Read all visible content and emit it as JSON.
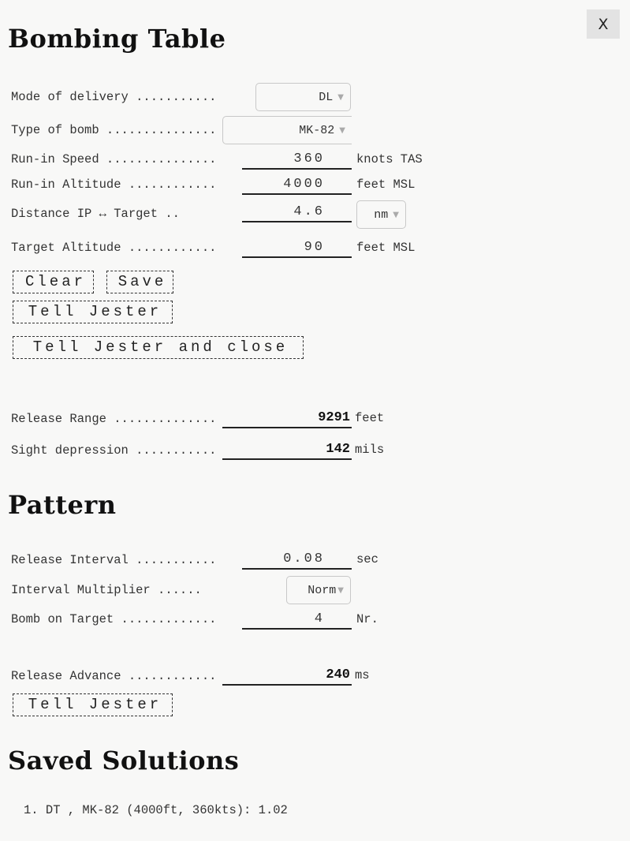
{
  "close_label": "X",
  "headings": {
    "bombing_table": "Bombing Table",
    "pattern": "Pattern",
    "saved_solutions": "Saved Solutions"
  },
  "bombing": {
    "mode": {
      "label": "Mode of delivery ...........",
      "value": "DL"
    },
    "bomb_type": {
      "label": "Type of bomb ..................",
      "value": "MK-82"
    },
    "speed": {
      "label": "Run-in Speed ...................",
      "value": "360",
      "unit": "knots TAS"
    },
    "altitude": {
      "label": "Run-in Altitude .............",
      "value": "4000",
      "unit": "feet MSL"
    },
    "distance": {
      "label": "Distance IP ↔ Target  ..",
      "value": "4.6",
      "unit": "nm"
    },
    "target_alt": {
      "label": "Target Altitude .............",
      "value": "90",
      "unit": "feet MSL"
    }
  },
  "buttons": {
    "clear": "Clear",
    "save": "Save",
    "tell_jester": "Tell Jester",
    "tell_jester_close": "Tell Jester and close",
    "tell_jester_pattern": "Tell Jester"
  },
  "results": {
    "release_range": {
      "label": "Release Range .................",
      "value": "9291",
      "unit": "feet"
    },
    "sight_depression": {
      "label": "Sight depression ...........",
      "value": "142",
      "unit": "mils"
    }
  },
  "pattern": {
    "interval": {
      "label": "Release Interval ...........",
      "value": "0.08",
      "unit": "sec"
    },
    "multiplier": {
      "label": "Interval Multiplier ......",
      "value": "Norm"
    },
    "bombs": {
      "label": "Bomb on Target ...............",
      "value": "4",
      "unit": "Nr."
    },
    "advance": {
      "label": "Release Advance .............",
      "value": "240",
      "unit": "ms"
    }
  },
  "saved_solutions": [
    "1. DT , MK-82 (4000ft, 360kts): 1.02"
  ]
}
